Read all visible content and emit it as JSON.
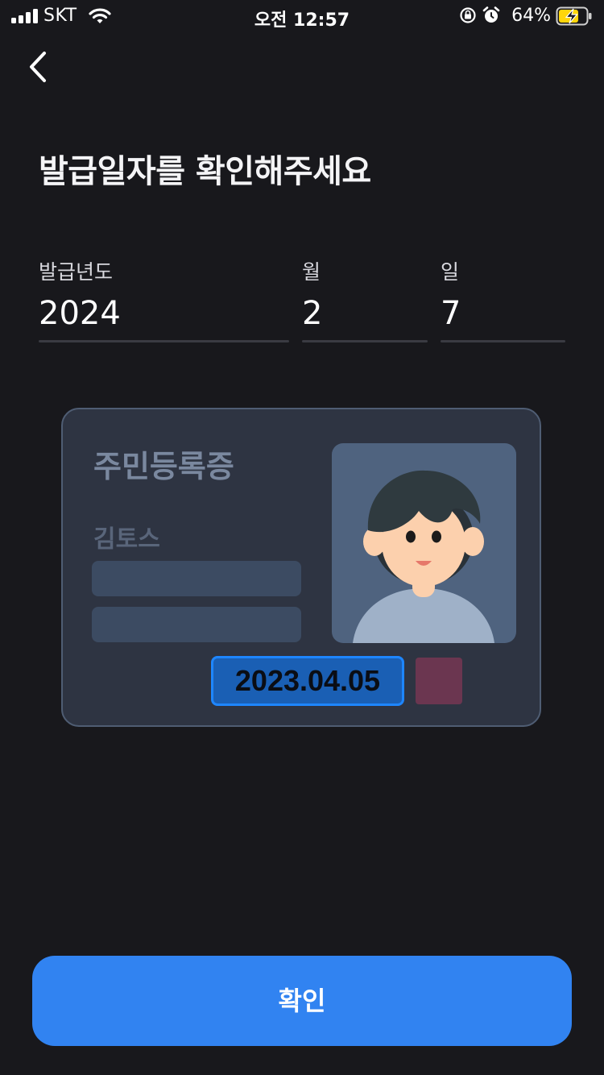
{
  "status_bar": {
    "carrier": "SKT",
    "time": "오전 12:57",
    "battery_percent": "64%",
    "icons": [
      "signal-icon",
      "wifi-icon",
      "rotation-lock-icon",
      "alarm-icon",
      "battery-charging-icon"
    ]
  },
  "header": {
    "back_icon": "chevron-left-icon"
  },
  "title": "발급일자를 확인해주세요",
  "form": {
    "year": {
      "label": "발급년도",
      "value": "2024"
    },
    "month": {
      "label": "월",
      "value": "2"
    },
    "day": {
      "label": "일",
      "value": "7"
    }
  },
  "id_card": {
    "title": "주민등록증",
    "name": "김토스",
    "issue_date": "2023.04.05"
  },
  "confirm_button": {
    "label": "확인"
  },
  "colors": {
    "background": "#18181c",
    "accent": "#3183f1",
    "card_bg": "#2e3442",
    "highlight": "#1e86ff"
  }
}
